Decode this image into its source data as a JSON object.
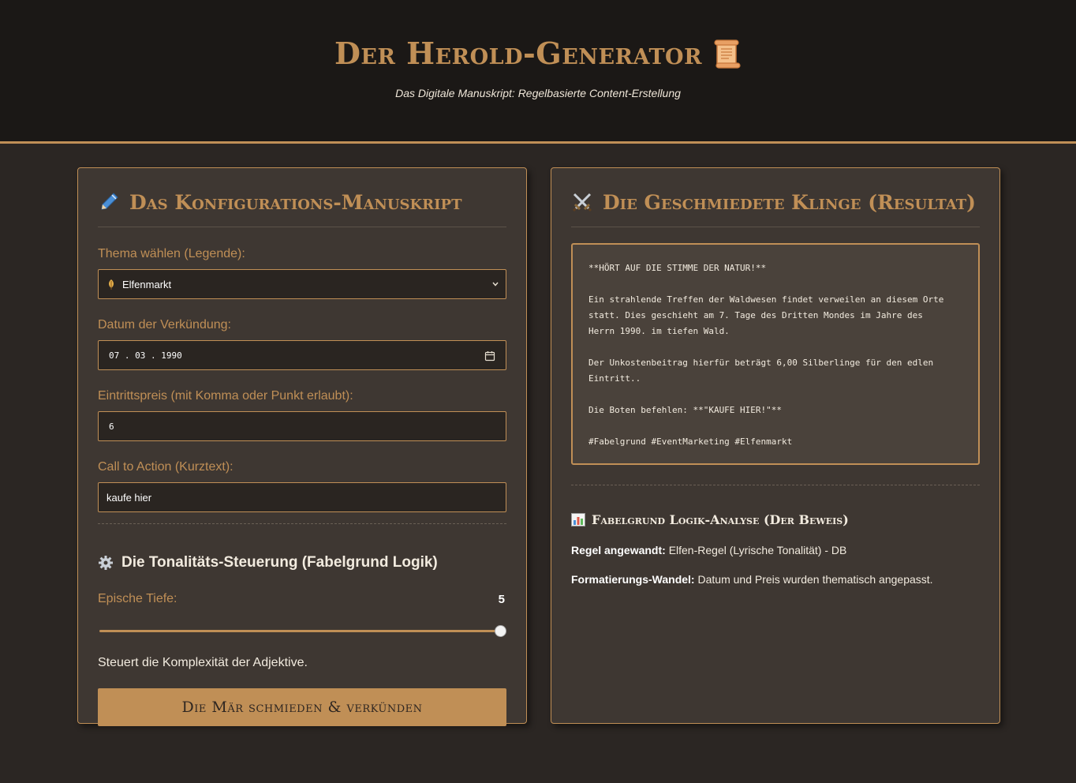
{
  "header": {
    "title": "Der Herold-Generator",
    "title_icon": "scroll-icon",
    "subtitle": "Das Digitale Manuskript: Regelbasierte Content-Erstellung"
  },
  "config": {
    "title": "Das Konfigurations-Manuskript",
    "title_icon": "pen-icon",
    "theme_label": "Thema wählen (Legende):",
    "theme_value": "Elfenmarkt",
    "date_label": "Datum der Verkündung:",
    "date_value": "07 . 03 . 1990",
    "price_label": "Eintrittspreis (mit Komma oder Punkt erlaubt):",
    "price_value": "6",
    "cta_label": "Call to Action (Kurztext):",
    "cta_value": "kaufe hier",
    "tone_title": "Die Tonalitäts-Steuerung (Fabelgrund Logik)",
    "tone_icon": "gear-icon",
    "slider_label": "Epische Tiefe:",
    "slider_value": "5",
    "slider_level": 1.0,
    "help_text": "Steuert die Komplexität der Adjektive.",
    "button_label": "Die Mär schmieden & verkünden"
  },
  "result": {
    "title": "Die Geschmiedete Klinge (Resultat)",
    "title_icon": "crossed-swords-icon",
    "output_lines": [
      "**HÖRT AUF DIE STIMME DER NATUR!**",
      "",
      "Ein strahlende Treffen der Waldwesen findet verweilen an diesem Orte",
      "statt. Dies geschieht am 7. Tage des Dritten Mondes im Jahre des",
      "Herrn 1990. im tiefen Wald.",
      "",
      "Der Unkostenbeitrag hierfür beträgt 6,00 Silberlinge für den edlen",
      "Eintritt..",
      "",
      "Die Boten befehlen: **\"KAUFE HIER!\"**",
      "",
      "#Fabelgrund #EventMarketing #Elfenmarkt"
    ],
    "analysis_title": "Fabelgrund Logik-Analyse (Der Beweis)",
    "analysis_icon": "bar-chart-icon",
    "rule_label": "Regel angewandt:",
    "rule_value": "Elfen-Regel (Lyrische Tonalität) - DB",
    "format_label": "Formatierungs-Wandel:",
    "format_value": "Datum und Preis wurden thematisch angepasst."
  },
  "colors": {
    "accent": "#c08f56",
    "background": "#2b2623",
    "panel": "#3e3732",
    "header": "#1b1816"
  }
}
